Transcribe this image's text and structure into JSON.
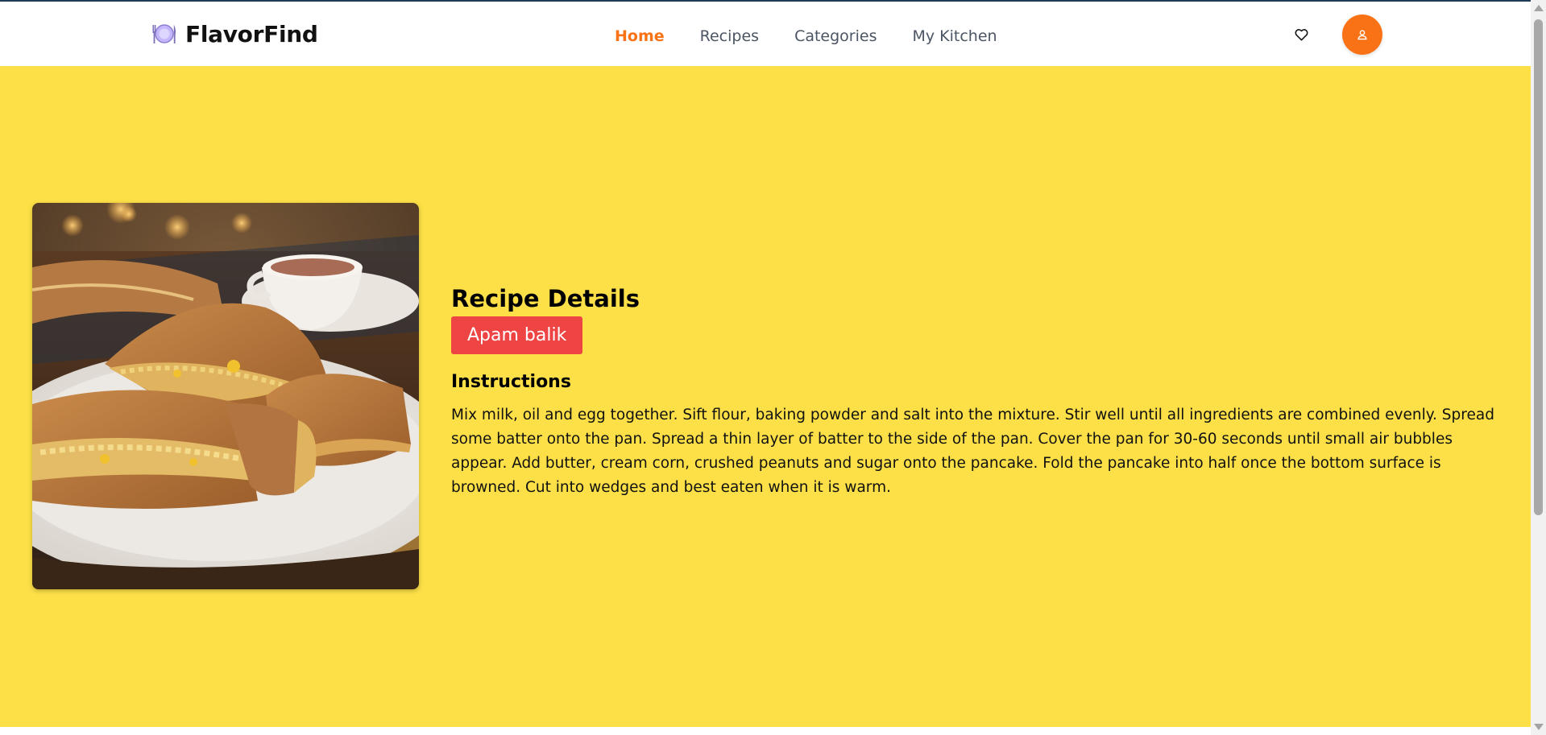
{
  "header": {
    "brand": "FlavorFind",
    "nav": [
      {
        "label": "Home",
        "active": true
      },
      {
        "label": "Recipes",
        "active": false
      },
      {
        "label": "Categories",
        "active": false
      },
      {
        "label": "My Kitchen",
        "active": false
      }
    ],
    "icons": {
      "brand": "plate-cutlery-icon",
      "favorites": "heart-icon",
      "profile": "user-icon"
    }
  },
  "colors": {
    "accent": "#f97316",
    "hero_background": "#fde047",
    "recipe_badge": "#ef4444"
  },
  "recipe": {
    "section_title": "Recipe Details",
    "name": "Apam balik",
    "instructions_heading": "Instructions",
    "instructions": "Mix milk, oil and egg together. Sift flour, baking powder and salt into the mixture. Stir well until all ingredients are combined evenly. Spread some batter onto the pan. Spread a thin layer of batter to the side of the pan. Cover the pan for 30-60 seconds until small air bubbles appear. Add butter, cream corn, crushed peanuts and sugar onto the pancake. Fold the pancake into half once the bottom surface is browned. Cut into wedges and best eaten when it is warm."
  }
}
